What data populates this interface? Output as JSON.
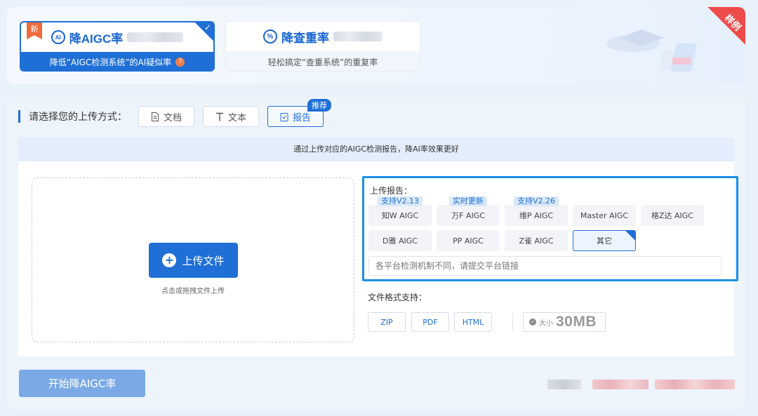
{
  "tabs": [
    {
      "badge_icon": "ai-icon",
      "badge_text": "AI",
      "title": "降AIGC率",
      "subtitle": "降低“AIGC检测系统”的AI疑似率",
      "new_label": "新",
      "help_label": "?"
    },
    {
      "badge_icon": "percent-icon",
      "badge_text": "%",
      "title": "降查重率",
      "subtitle": "轻松搞定“查重系统”的重复率"
    }
  ],
  "example_label": "样例",
  "upload_method": {
    "label": "请选择您的上传方式：",
    "options": [
      {
        "label": "文档",
        "icon": "document-icon"
      },
      {
        "label": "文本",
        "icon": "text-icon"
      },
      {
        "label": "报告",
        "icon": "report-icon",
        "badge": "推荐"
      }
    ]
  },
  "notice": "通过上传对应的AIGC检测报告，降AI率效果更好",
  "upload": {
    "button_label": "上传文件",
    "hint": "点击或拖拽文件上传"
  },
  "report": {
    "title": "上传报告：",
    "platforms": [
      {
        "label": "知W AIGC",
        "tag": "支持V2.13"
      },
      {
        "label": "万F AIGC",
        "tag": "实时更新"
      },
      {
        "label": "维P AIGC",
        "tag": "支持V2.26"
      },
      {
        "label": "Master AIGC"
      },
      {
        "label": "格Z达 AIGC"
      },
      {
        "label": "D雅 AIGC"
      },
      {
        "label": "PP AIGC"
      },
      {
        "label": "Z雀 AIGC"
      },
      {
        "label": "其它"
      }
    ],
    "link_placeholder": "各平台检测机制不同，请提交平台链接"
  },
  "formats": {
    "label": "文件格式支持：",
    "types": [
      "ZIP",
      "PDF",
      "HTML"
    ],
    "size_label": "大小",
    "size_value": "30MB"
  },
  "start_button": "开始降AIGC率",
  "colors": {
    "primary": "#1f6fd6",
    "accent": "#1a8fe6",
    "ribbon": "#ee4b4b",
    "new": "#f06a3b"
  }
}
